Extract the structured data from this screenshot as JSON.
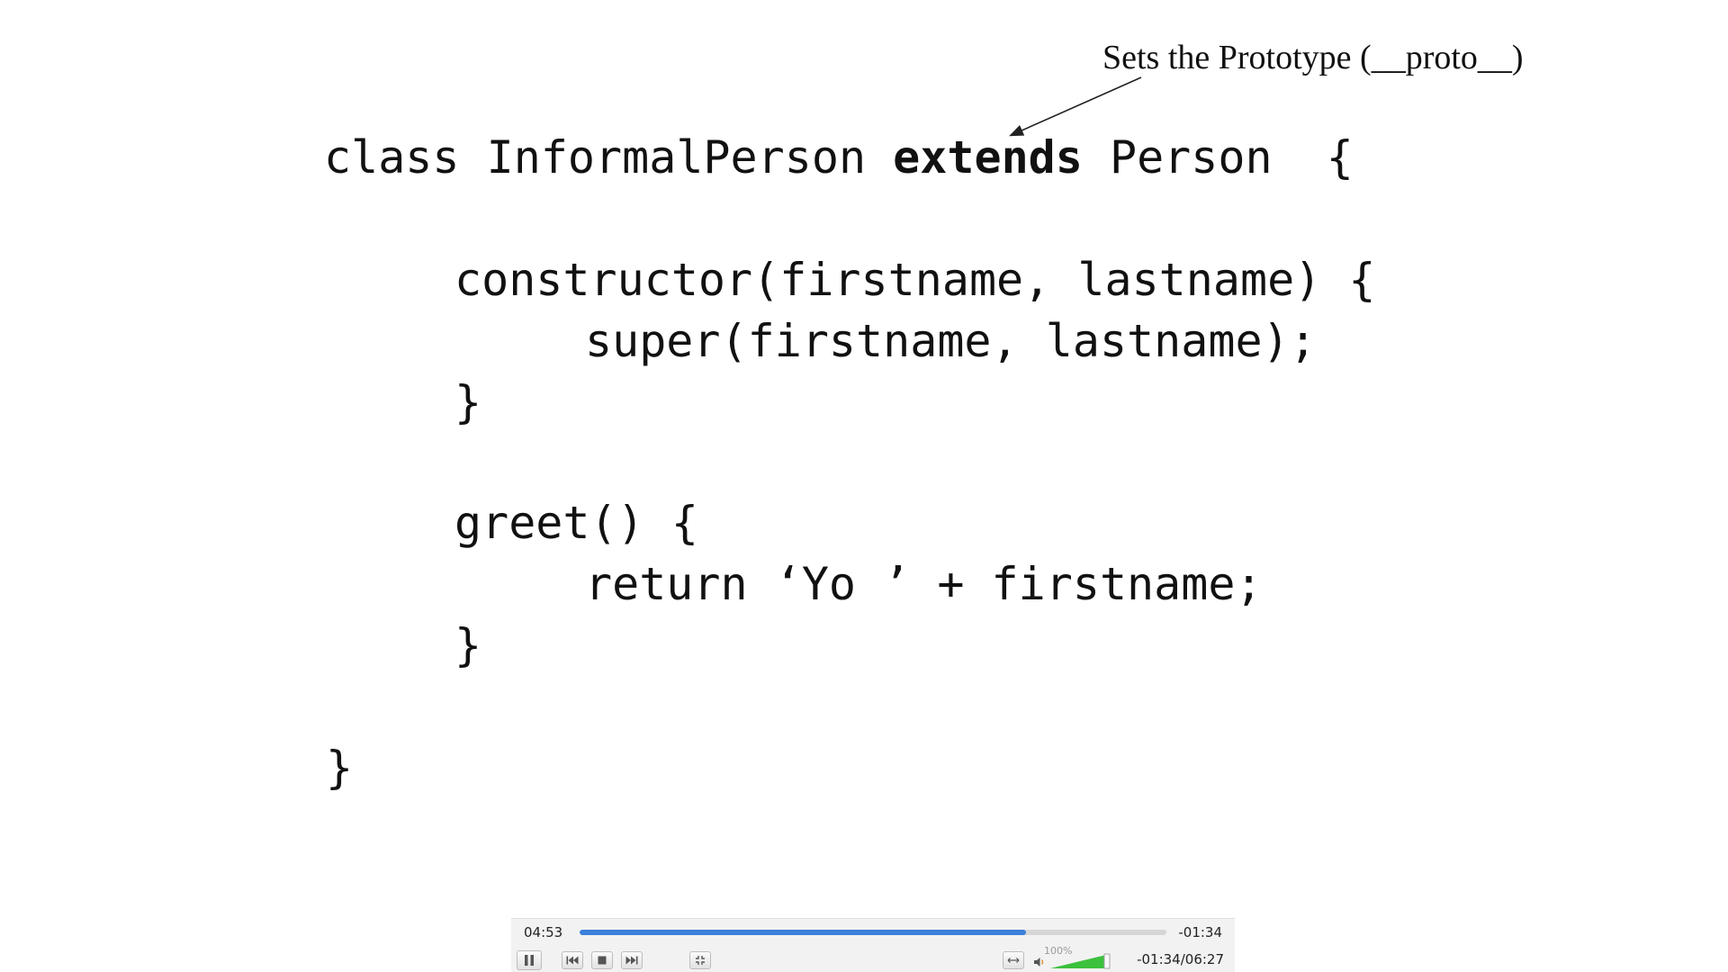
{
  "annotation": {
    "text": "Sets the Prototype (__proto__)"
  },
  "code": {
    "class_line": {
      "before": "class InformalPerson ",
      "keyword": "extends",
      "after": " Person  {"
    },
    "constructor_line": "constructor(firstname, lastname) {",
    "super_line": "super(firstname, lastname);",
    "constructor_close": "}",
    "greet_line": "greet() {",
    "return_line": "return ‘Yo ’ + firstname;",
    "greet_close": "}",
    "class_close": "}"
  },
  "player": {
    "elapsed": "04:53",
    "remaining": "-01:34",
    "remaining_total": "-01:34/06:27",
    "progress_fraction": 0.76,
    "volume_label": "100%",
    "volume_fraction": 1.0,
    "accent_color": "#3a7fd9",
    "volume_color": "#3cc13c",
    "icons": {
      "pause": "pause-icon",
      "prev": "skip-previous-icon",
      "stop": "stop-icon",
      "next": "skip-next-icon",
      "fullscreen": "fullscreen-exit-icon",
      "ratio": "aspect-ratio-icon",
      "volume": "speaker-icon"
    }
  }
}
